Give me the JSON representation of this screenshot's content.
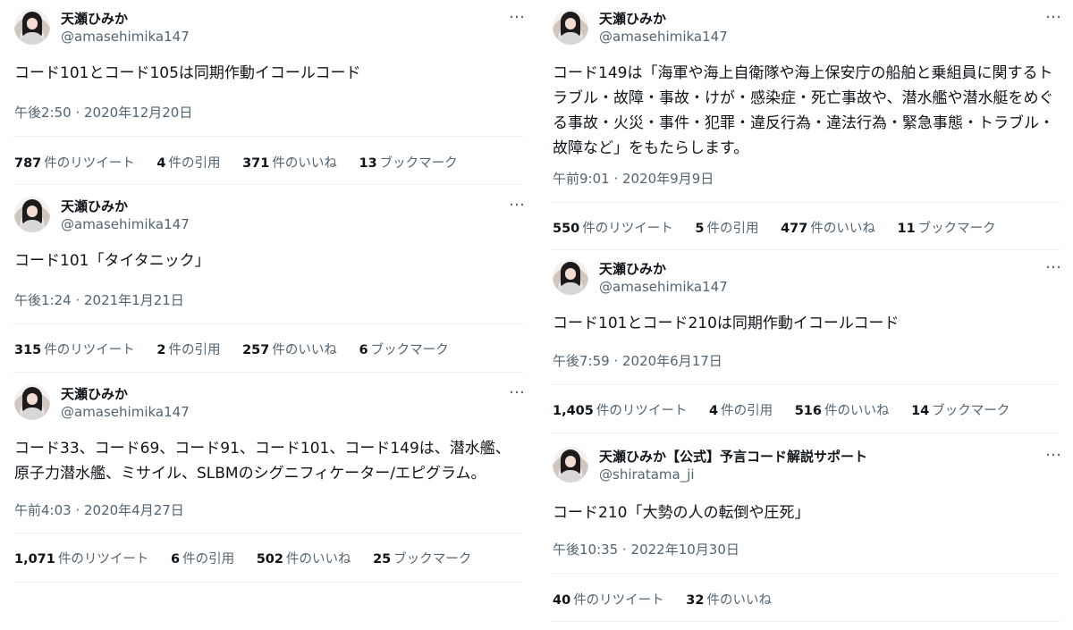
{
  "tweets_left": [
    {
      "name": "天瀬ひみか",
      "handle": "@amasehimika147",
      "text": "コード101とコード105は同期作動イコールコード",
      "timestamp": "午後2:50 · 2020年12月20日",
      "stats": {
        "retweets": {
          "count": "787",
          "label": "件のリツイート"
        },
        "quotes": {
          "count": "4",
          "label": "件の引用"
        },
        "likes": {
          "count": "371",
          "label": "件のいいね"
        },
        "bookmarks": {
          "count": "13",
          "label": "ブックマーク"
        }
      }
    },
    {
      "name": "天瀬ひみか",
      "handle": "@amasehimika147",
      "text": "コード101「タイタニック」",
      "timestamp": "午後1:24 · 2021年1月21日",
      "stats": {
        "retweets": {
          "count": "315",
          "label": "件のリツイート"
        },
        "quotes": {
          "count": "2",
          "label": "件の引用"
        },
        "likes": {
          "count": "257",
          "label": "件のいいね"
        },
        "bookmarks": {
          "count": "6",
          "label": "ブックマーク"
        }
      }
    },
    {
      "name": "天瀬ひみか",
      "handle": "@amasehimika147",
      "text": "コード33、コード69、コード91、コード101、コード149は、潜水艦、原子力潜水艦、ミサイル、SLBMのシグニフィケーター/エピグラム。",
      "timestamp": "午前4:03 · 2020年4月27日",
      "stats": {
        "retweets": {
          "count": "1,071",
          "label": "件のリツイート"
        },
        "quotes": {
          "count": "6",
          "label": "件の引用"
        },
        "likes": {
          "count": "502",
          "label": "件のいいね"
        },
        "bookmarks": {
          "count": "25",
          "label": "ブックマーク"
        }
      }
    }
  ],
  "tweets_right": [
    {
      "name": "天瀬ひみか",
      "handle": "@amasehimika147",
      "text": "コード149は「海軍や海上自衛隊や海上保安庁の船舶と乗組員に関するトラブル・故障・事故・けが・感染症・死亡事故や、潜水艦や潜水艇をめぐる事故・火災・事件・犯罪・違反行為・違法行為・緊急事態・トラブル・故障など」をもたらします。",
      "timestamp": "午前9:01 · 2020年9月9日",
      "stats": {
        "retweets": {
          "count": "550",
          "label": "件のリツイート"
        },
        "quotes": {
          "count": "5",
          "label": "件の引用"
        },
        "likes": {
          "count": "477",
          "label": "件のいいね"
        },
        "bookmarks": {
          "count": "11",
          "label": "ブックマーク"
        }
      }
    },
    {
      "name": "天瀬ひみか",
      "handle": "@amasehimika147",
      "text": "コード101とコード210は同期作動イコールコード",
      "timestamp": "午後7:59 · 2020年6月17日",
      "stats": {
        "retweets": {
          "count": "1,405",
          "label": "件のリツイート"
        },
        "quotes": {
          "count": "4",
          "label": "件の引用"
        },
        "likes": {
          "count": "516",
          "label": "件のいいね"
        },
        "bookmarks": {
          "count": "14",
          "label": "ブックマーク"
        }
      }
    },
    {
      "name": "天瀬ひみか【公式】予言コード解説サポート",
      "handle": "@shiratama_ji",
      "text": "コード210「大勢の人の転倒や圧死」",
      "timestamp": "午後10:35 · 2022年10月30日",
      "stats": {
        "retweets": {
          "count": "40",
          "label": "件のリツイート"
        },
        "likes": {
          "count": "32",
          "label": "件のいいね"
        }
      }
    }
  ],
  "more_icon": "…",
  "colors": {
    "text": "#0f1419",
    "secondary": "#536471",
    "divider": "#eff3f4"
  }
}
